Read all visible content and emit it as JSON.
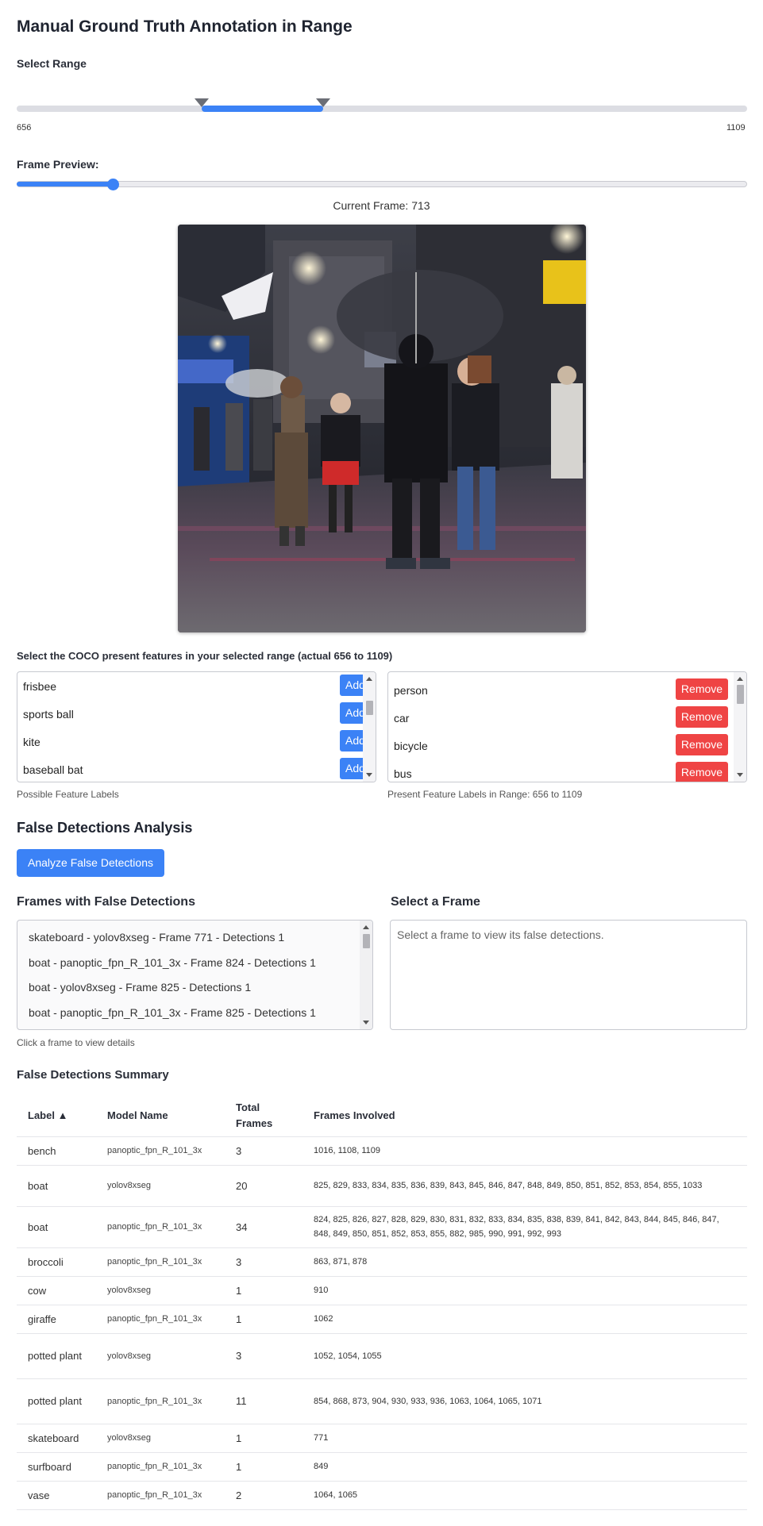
{
  "title": "Manual Ground Truth Annotation in Range",
  "range": {
    "label": "Select Range",
    "min": "656",
    "max": "1109",
    "selected_start_pct": 25.3,
    "selected_end_pct": 42.0
  },
  "preview": {
    "label": "Frame Preview:",
    "current_frame_text": "Current Frame: 713",
    "slider_pct": 13.1
  },
  "coco": {
    "title": "Select the COCO present features in your selected range (actual 656 to 1109)",
    "possible": [
      "frisbee",
      "sports ball",
      "kite",
      "baseball bat"
    ],
    "possible_caption": "Possible Feature Labels",
    "add_label": "Add",
    "present": [
      "person",
      "car",
      "bicycle",
      "bus"
    ],
    "present_caption": "Present Feature Labels in Range: 656 to 1109",
    "remove_label": "Remove"
  },
  "false_detections": {
    "title": "False Detections Analysis",
    "analyze_button": "Analyze False Detections",
    "frames_title": "Frames with False Detections",
    "frames": [
      "skateboard - yolov8xseg - Frame 771 - Detections 1",
      "boat - panoptic_fpn_R_101_3x - Frame 824 - Detections 1",
      "boat - yolov8xseg - Frame 825 - Detections 1",
      "boat - panoptic_fpn_R_101_3x - Frame 825 - Detections 1"
    ],
    "frames_caption": "Click a frame to view details",
    "select_title": "Select a Frame",
    "select_placeholder": "Select a frame to view its false detections."
  },
  "summary": {
    "title": "False Detections Summary",
    "headers": [
      "Label ▲",
      "Model Name",
      "Total\nFrames",
      "Frames Involved"
    ],
    "rows": [
      [
        "bench",
        "panoptic_fpn_R_101_3x",
        "3",
        "1016, 1108, 1109"
      ],
      [
        "boat",
        "yolov8xseg",
        "20",
        "825, 829, 833, 834, 835, 836, 839, 843, 845, 846, 847, 848, 849, 850, 851, 852, 853, 854, 855, 1033"
      ],
      [
        "boat",
        "panoptic_fpn_R_101_3x",
        "34",
        "824, 825, 826, 827, 828, 829, 830, 831, 832, 833, 834, 835, 838, 839, 841, 842, 843, 844, 845, 846, 847, 848, 849, 850, 851, 852, 853, 855, 882, 985, 990, 991, 992, 993"
      ],
      [
        "broccoli",
        "panoptic_fpn_R_101_3x",
        "3",
        "863, 871, 878"
      ],
      [
        "cow",
        "yolov8xseg",
        "1",
        "910"
      ],
      [
        "giraffe",
        "panoptic_fpn_R_101_3x",
        "1",
        "1062"
      ],
      [
        "potted plant",
        "yolov8xseg",
        "3",
        "1052, 1054, 1055"
      ],
      [
        "potted plant",
        "panoptic_fpn_R_101_3x",
        "11",
        "854, 868, 873, 904, 930, 933, 936, 1063, 1064, 1065, 1071"
      ],
      [
        "skateboard",
        "yolov8xseg",
        "1",
        "771"
      ],
      [
        "surfboard",
        "panoptic_fpn_R_101_3x",
        "1",
        "849"
      ],
      [
        "vase",
        "panoptic_fpn_R_101_3x",
        "2",
        "1064, 1065"
      ]
    ]
  },
  "colors": {
    "accent": "#3b82f6",
    "danger": "#ef4444"
  }
}
